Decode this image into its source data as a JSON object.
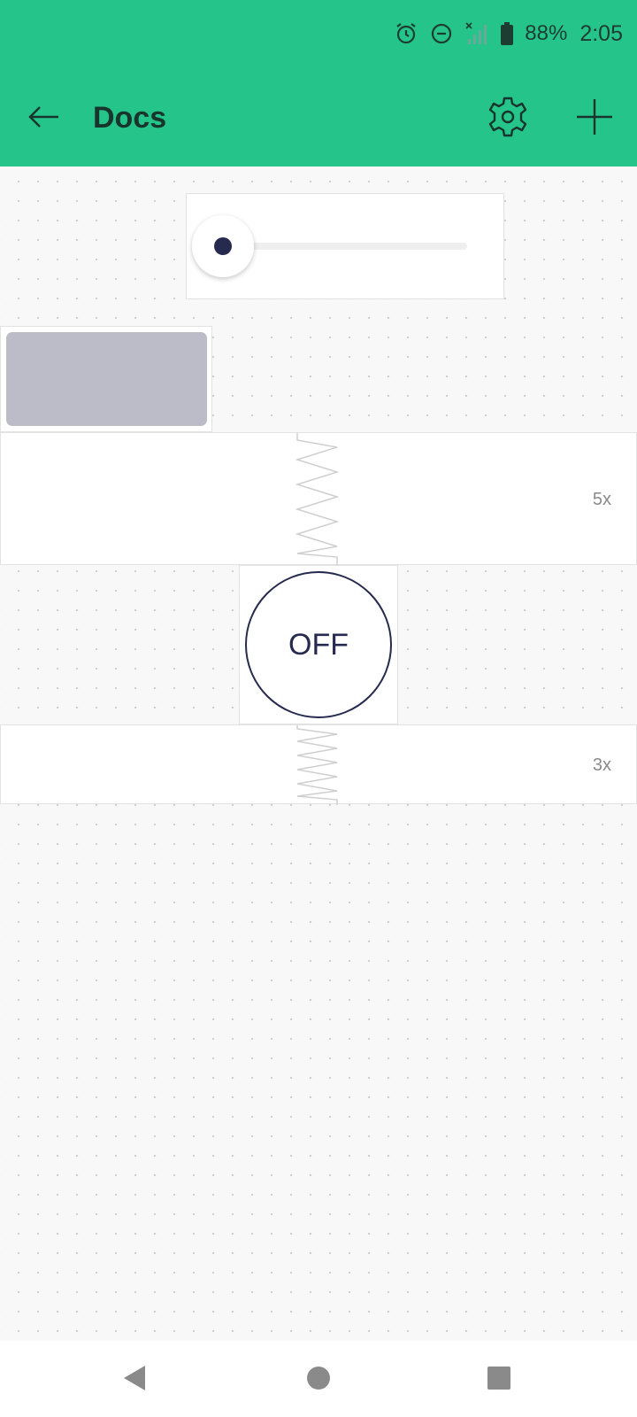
{
  "status_bar": {
    "battery": "88%",
    "time": "2:05",
    "icons": [
      "alarm-icon",
      "do-not-disturb-icon",
      "no-signal-icon",
      "battery-icon"
    ]
  },
  "app_bar": {
    "title": "Docs",
    "back_icon": "arrow-left-icon",
    "settings_icon": "gear-icon",
    "add_icon": "plus-icon"
  },
  "widgets": {
    "slider": {
      "value": 0
    },
    "spacer_1": {
      "multiplier": "5x"
    },
    "toggle_button": {
      "label": "OFF"
    },
    "spacer_2": {
      "multiplier": "3x"
    }
  },
  "colors": {
    "header": "#25c48b",
    "accent": "#262a4f",
    "label_fill": "#bbbcc8"
  },
  "nav_bar": {
    "icons": [
      "back-triangle-icon",
      "home-circle-icon",
      "recents-square-icon"
    ]
  }
}
